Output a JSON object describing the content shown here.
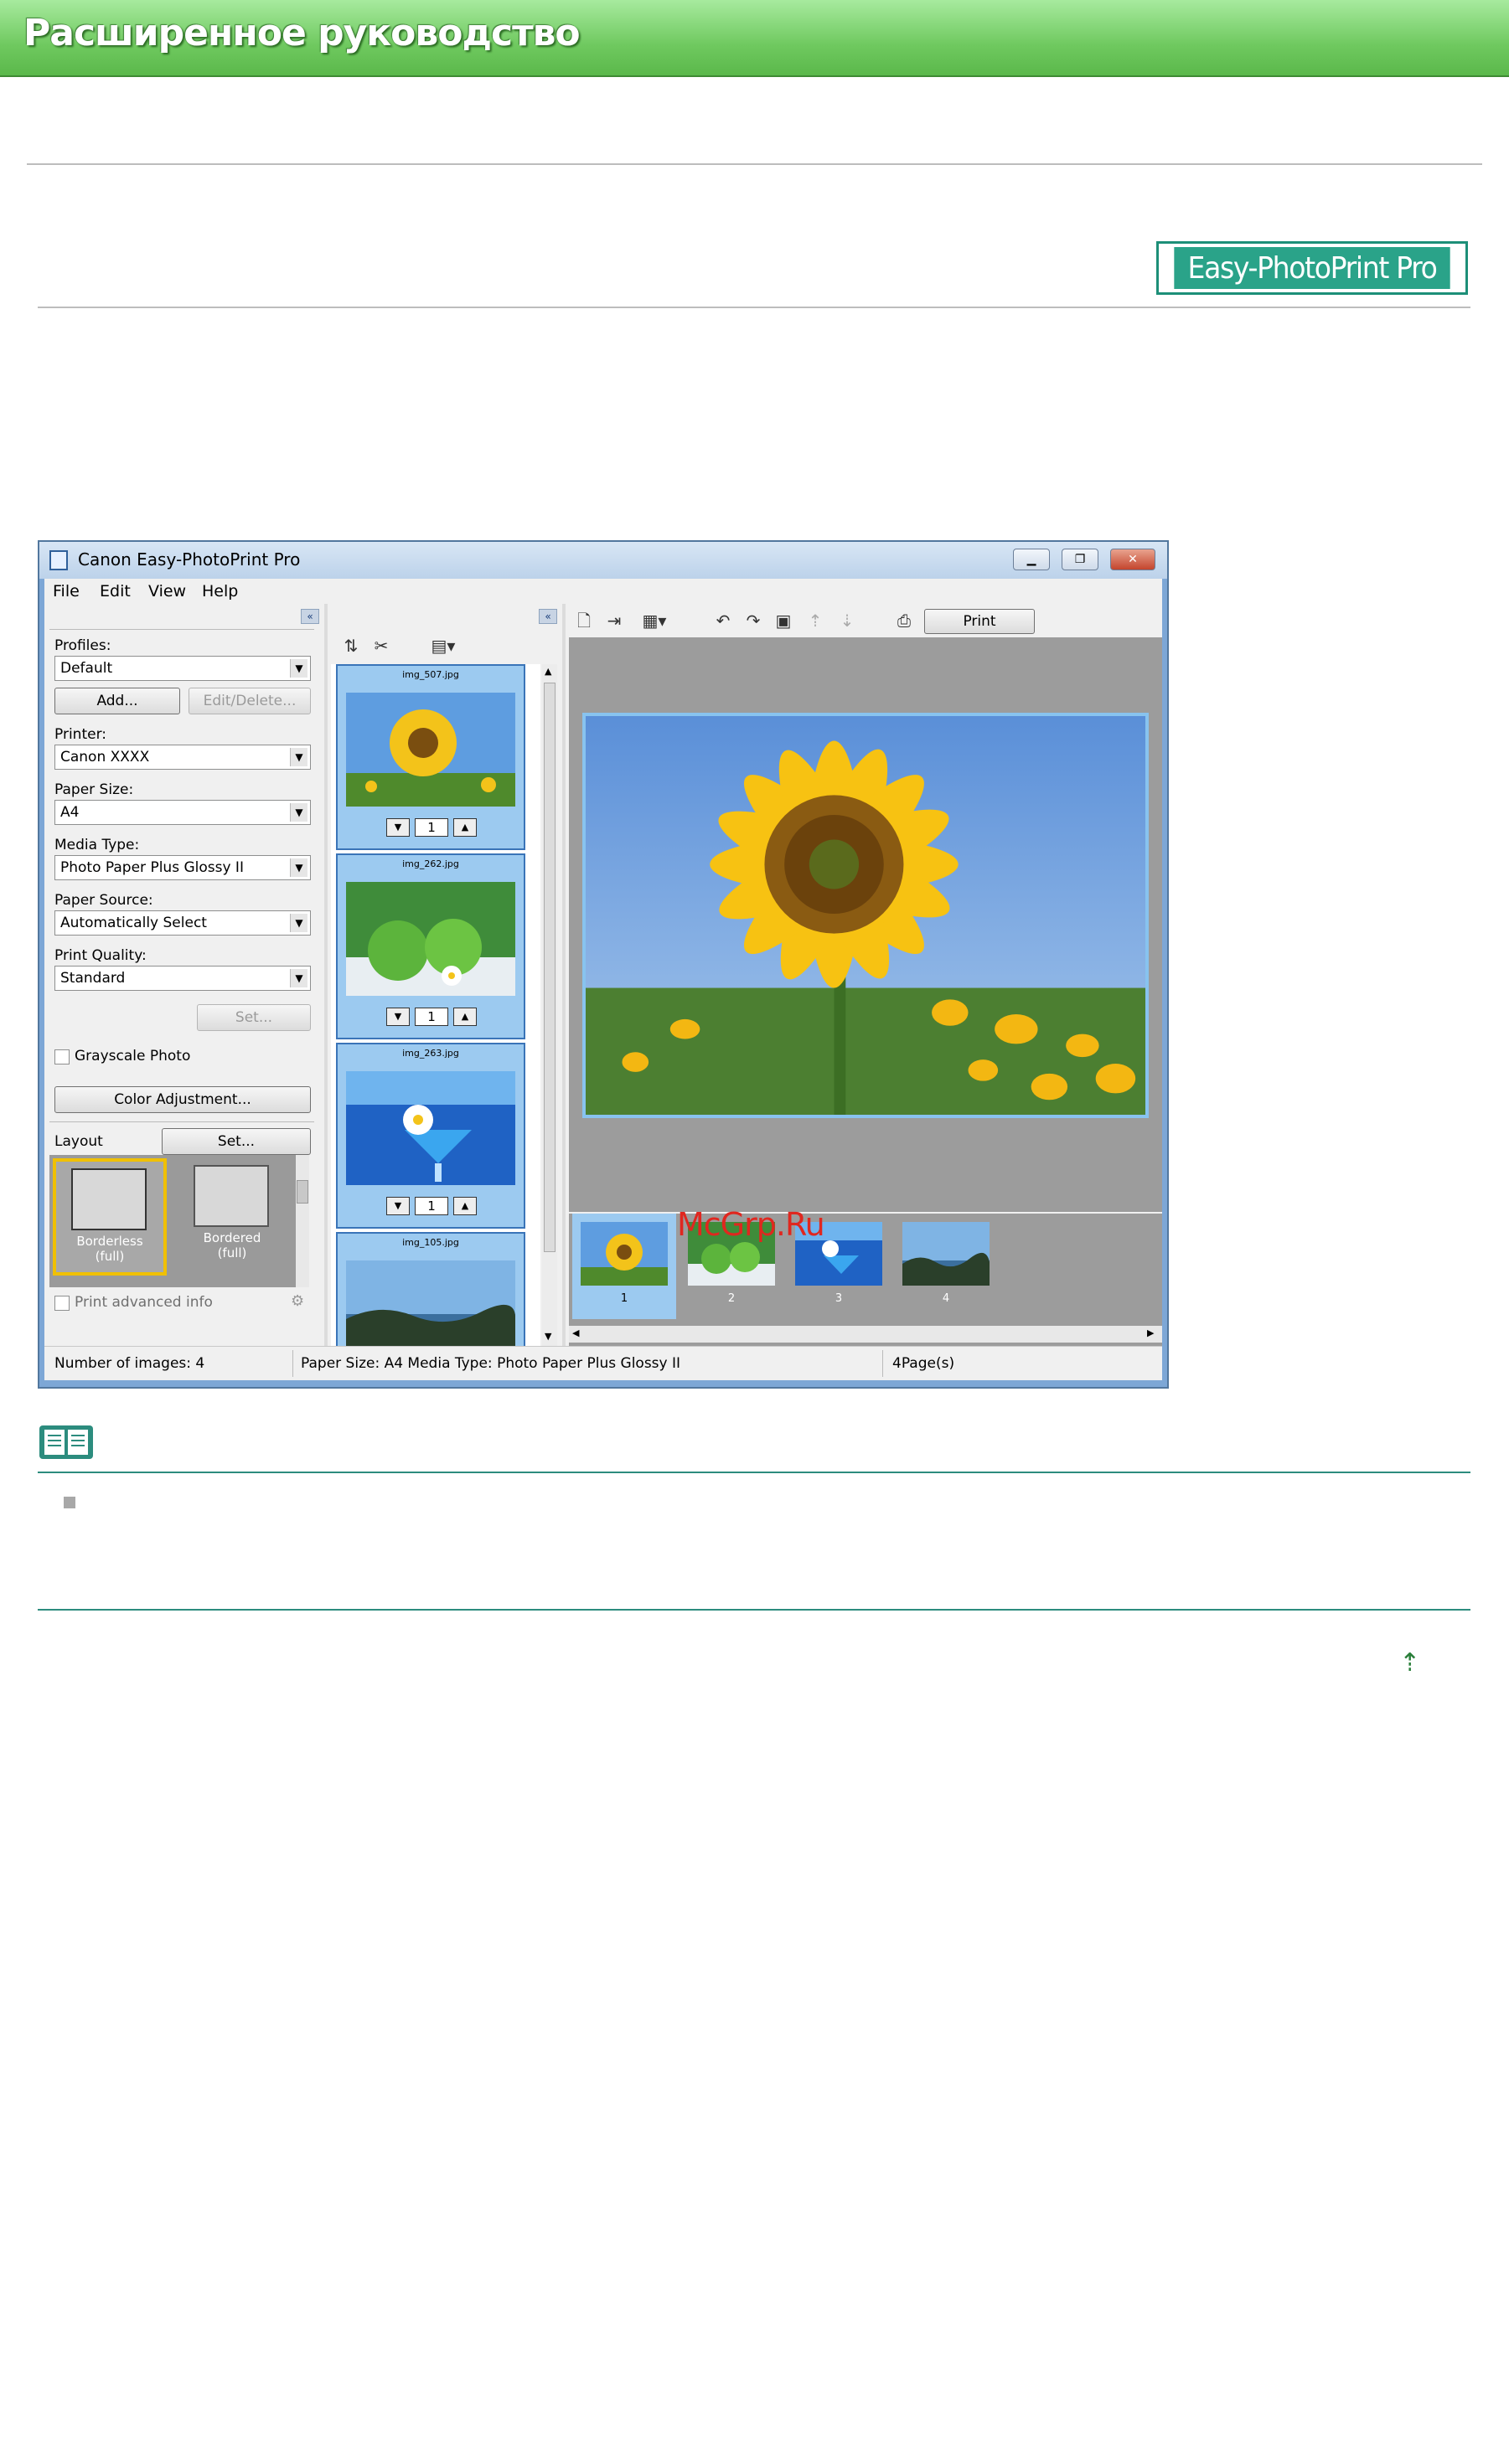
{
  "header": {
    "title": "Расширенное руководство"
  },
  "badge": {
    "label": "Easy-PhotoPrint Pro"
  },
  "window": {
    "title": "Canon Easy-PhotoPrint Pro",
    "menu": [
      "File",
      "Edit",
      "View",
      "Help"
    ],
    "left_panel": {
      "profiles_label": "Profiles:",
      "profiles_value": "Default",
      "add_button": "Add...",
      "edit_delete_button": "Edit/Delete...",
      "printer_label": "Printer:",
      "printer_value": "Canon XXXX",
      "paper_size_label": "Paper Size:",
      "paper_size_value": "A4",
      "media_type_label": "Media Type:",
      "media_type_value": "Photo Paper Plus Glossy II",
      "paper_source_label": "Paper Source:",
      "paper_source_value": "Automatically Select",
      "print_quality_label": "Print Quality:",
      "print_quality_value": "Standard",
      "set_button": "Set...",
      "grayscale_label": "Grayscale Photo",
      "color_adjust_button": "Color Adjustment...",
      "layout_label": "Layout",
      "layout_set_button": "Set...",
      "layouts": [
        {
          "caption": "Borderless\n(full)",
          "selected": true
        },
        {
          "caption": "Bordered\n(full)",
          "selected": false
        }
      ],
      "print_advanced_label": "Print advanced info"
    },
    "photos": [
      {
        "name": "img_507.jpg",
        "copies": "1"
      },
      {
        "name": "img_262.jpg",
        "copies": "1"
      },
      {
        "name": "img_263.jpg",
        "copies": "1"
      },
      {
        "name": "img_105.jpg",
        "copies": ""
      }
    ],
    "print_button": "Print",
    "strip": [
      "1",
      "2",
      "3",
      "4"
    ],
    "status": {
      "images": "Number of images: 4",
      "paper": "Paper Size: A4  Media Type: Photo Paper Plus Glossy II",
      "pages": "4Page(s)"
    }
  },
  "watermark": "McGrp.Ru",
  "colors": {
    "header_green": "#6fc95f",
    "badge_teal": "#2aa389",
    "rule_teal": "#2c8c7e"
  },
  "icons": [
    "book-note-icon",
    "up-arrow-icon"
  ]
}
